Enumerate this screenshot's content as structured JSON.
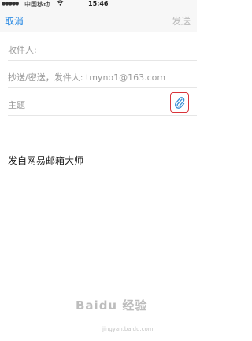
{
  "status_bar": {
    "signal": "●●●●●",
    "carrier": "中国移动",
    "wifi_icon": "wifi-icon",
    "time": "15:46"
  },
  "nav": {
    "cancel_label": "取消",
    "send_label": "发送",
    "send_color": "#bcbcbc",
    "accent_color": "#2f8de4"
  },
  "compose": {
    "to_label": "收件人:",
    "cc_label": "抄送/密送，发件人: tmyno1@163.com",
    "subject_placeholder": "主题",
    "attach_icon": "paperclip-icon",
    "highlight_color": "#d9343a",
    "signature": "发自网易邮箱大师"
  },
  "watermark": {
    "logo": "Baidu 经验",
    "url": "jingyan.baidu.com"
  }
}
